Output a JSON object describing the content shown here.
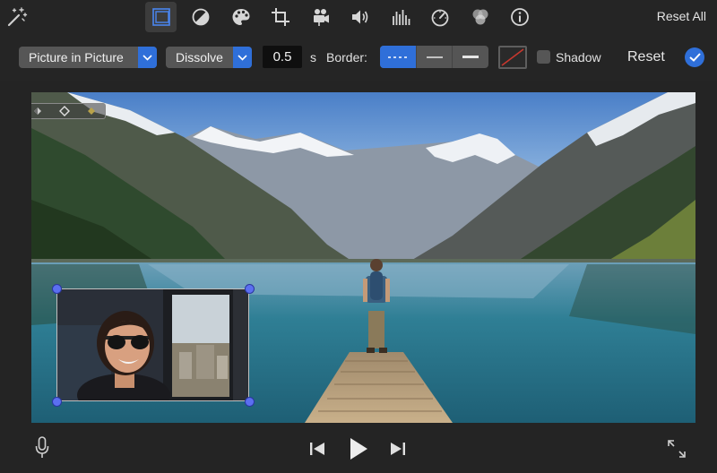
{
  "toolbar": {
    "tools": [
      {
        "name": "video-overlay-icon",
        "active": true
      },
      {
        "name": "color-balance-icon",
        "active": false
      },
      {
        "name": "color-palette-icon",
        "active": false
      },
      {
        "name": "crop-icon",
        "active": false
      },
      {
        "name": "stabilization-camera-icon",
        "active": false
      },
      {
        "name": "volume-icon",
        "active": false
      },
      {
        "name": "equalizer-icon",
        "active": false
      },
      {
        "name": "speed-gauge-icon",
        "active": false
      },
      {
        "name": "clip-filter-icon",
        "active": false
      },
      {
        "name": "info-icon",
        "active": false
      }
    ],
    "reset_all_label": "Reset All"
  },
  "controls": {
    "overlay_style": "Picture in Picture",
    "transition": "Dissolve",
    "duration_value": "0.5",
    "duration_unit": "s",
    "border_label": "Border:",
    "border_styles": [
      "dashed",
      "thin",
      "thick"
    ],
    "border_selected": "dashed",
    "shadow_label": "Shadow",
    "shadow_checked": false,
    "reset_label": "Reset"
  },
  "colors": {
    "accent": "#2f6fd9",
    "handle": "#5b6ff0",
    "background": "#242424"
  },
  "viewer": {
    "main_clip": "mountain-lake-hiker-on-dock",
    "pip_clip": "woman-sunglasses-train-window"
  },
  "transport": {
    "icons": [
      "microphone-icon",
      "skip-back-icon",
      "play-icon",
      "skip-forward-icon",
      "fullscreen-icon"
    ]
  }
}
